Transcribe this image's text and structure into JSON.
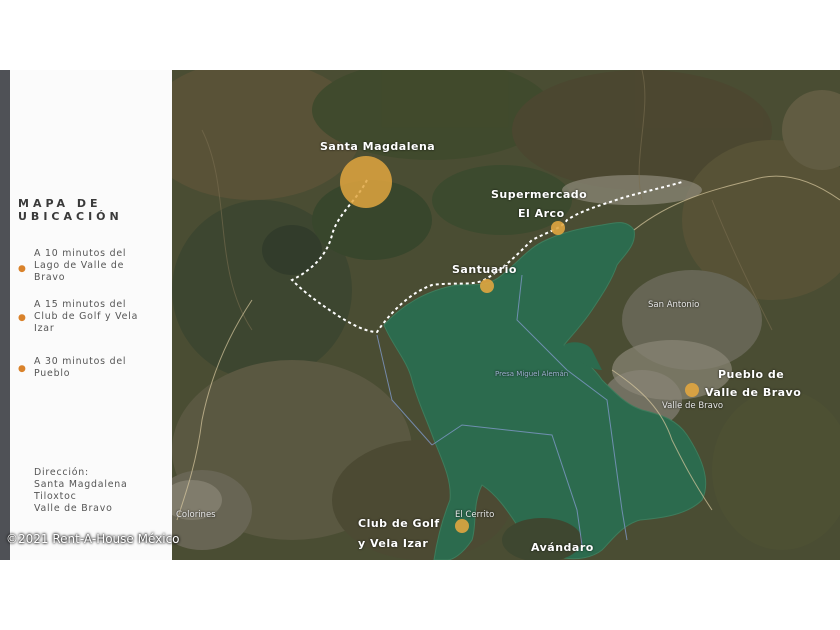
{
  "sidebar": {
    "heading_line1": "MAPA DE",
    "heading_line2": "UBICACIÓN",
    "items": [
      {
        "lines": [
          "A 10 minutos del",
          "Lago de Valle de",
          "Bravo"
        ]
      },
      {
        "lines": [
          "A 15 minutos del",
          "Club de Golf y Vela",
          "Izar"
        ]
      },
      {
        "lines": [
          "A 30 minutos del",
          "Pueblo"
        ]
      }
    ],
    "address": [
      "Dirección:",
      "Santa Magdalena",
      "Tiloxtoc",
      "Valle de Bravo"
    ]
  },
  "map": {
    "places": {
      "santa_magdalena": "Santa Magdalena",
      "supermercado_line1": "Supermercado",
      "supermercado_line2": "El Arco",
      "santuario": "Santuario",
      "pueblo_line1": "Pueblo de",
      "pueblo_line2": "Valle de Bravo",
      "club_line1": "Club de Golf",
      "club_line2": "y Vela Izar",
      "avandaro": "Avándaro"
    },
    "small_labels": {
      "san_antonio": "San Antonio",
      "valle_de_bravo": "Valle de Bravo",
      "el_cerrito": "El Cerrito",
      "presa": "Presa Miguel Alemán",
      "colorines": "Colorines"
    },
    "colors": {
      "marker": "#e0a640",
      "lake": "#2c6b4e",
      "route": "#ffffff"
    }
  },
  "watermark": "©2021 Rent-A-House México"
}
